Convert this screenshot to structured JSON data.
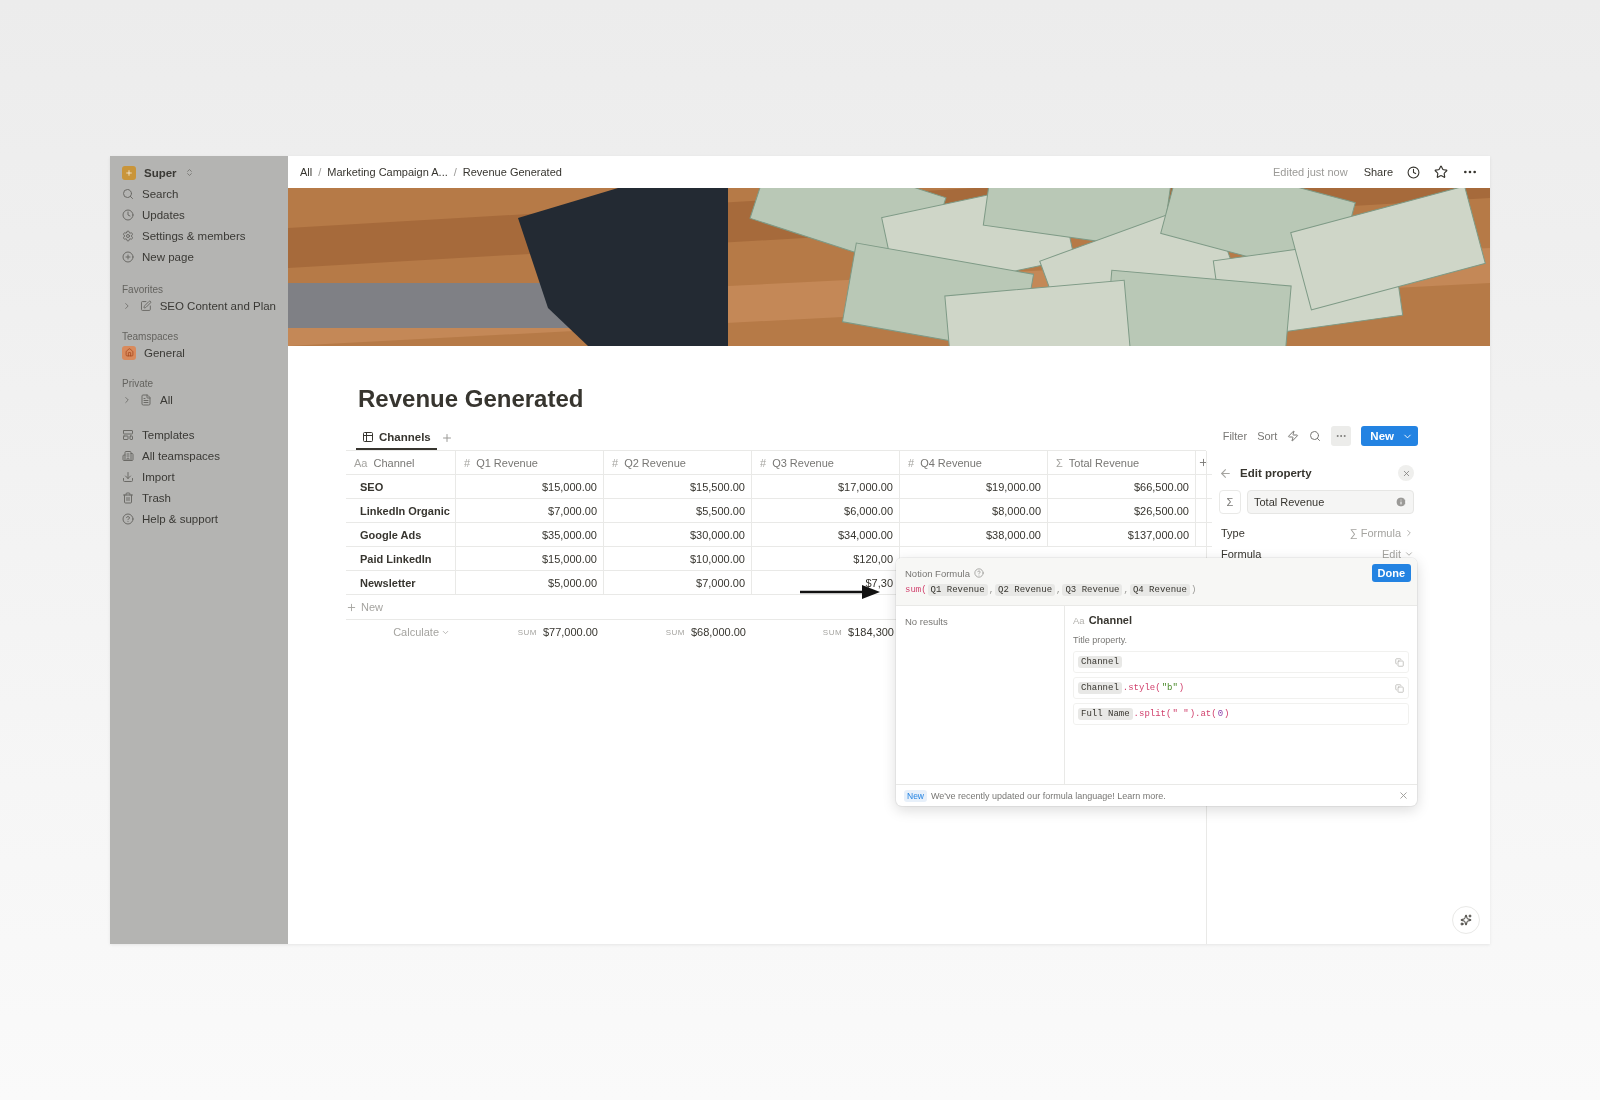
{
  "sidebar": {
    "workspace": {
      "name": "Super"
    },
    "nav": [
      {
        "label": "Search"
      },
      {
        "label": "Updates"
      },
      {
        "label": "Settings & members"
      },
      {
        "label": "New page"
      }
    ],
    "sections": [
      {
        "title": "Favorites",
        "items": [
          {
            "label": "SEO Content and Plan",
            "expanded": false
          }
        ]
      },
      {
        "title": "Teamspaces",
        "items": [
          {
            "label": "General"
          }
        ]
      },
      {
        "title": "Private",
        "items": [
          {
            "label": "All",
            "expanded": false
          }
        ]
      }
    ],
    "tools": [
      {
        "label": "Templates"
      },
      {
        "label": "All teamspaces"
      },
      {
        "label": "Import"
      },
      {
        "label": "Trash"
      },
      {
        "label": "Help & support"
      }
    ]
  },
  "topbar": {
    "breadcrumbs": [
      {
        "kind": "crumb",
        "text": "All"
      },
      {
        "kind": "separator",
        "text": "/"
      },
      {
        "kind": "crumb",
        "text": "Marketing Campaign A..."
      },
      {
        "kind": "separator",
        "text": "/"
      },
      {
        "kind": "crumb",
        "text": "Revenue Generated"
      }
    ],
    "status": "Edited just now",
    "share": "Share"
  },
  "page": {
    "title": "Revenue Generated"
  },
  "views": [
    {
      "label": "Channels",
      "selected": true
    }
  ],
  "toolbar": {
    "filter": "Filter",
    "sort": "Sort",
    "new": "New"
  },
  "table": {
    "columns": [
      {
        "icon": "Aa",
        "name": "Channel"
      },
      {
        "icon": "#",
        "name": "Q1 Revenue"
      },
      {
        "icon": "#",
        "name": "Q2 Revenue"
      },
      {
        "icon": "#",
        "name": "Q3 Revenue"
      },
      {
        "icon": "#",
        "name": "Q4 Revenue"
      },
      {
        "icon": "Σ",
        "name": "Total Revenue"
      }
    ],
    "rows": [
      {
        "cells": [
          "SEO",
          "$15,000.00",
          "$15,500.00",
          "$17,000.00",
          "$19,000.00",
          "$66,500.00"
        ]
      },
      {
        "cells": [
          "LinkedIn Organic",
          "$7,000.00",
          "$5,500.00",
          "$6,000.00",
          "$8,000.00",
          "$26,500.00"
        ]
      },
      {
        "cells": [
          "Google Ads",
          "$35,000.00",
          "$30,000.00",
          "$34,000.00",
          "$38,000.00",
          "$137,000.00"
        ]
      },
      {
        "cells": [
          "Paid LinkedIn",
          "$15,000.00",
          "$10,000.00",
          "$120,00"
        ]
      },
      {
        "cells": [
          "Newsletter",
          "$5,000.00",
          "$7,000.00",
          "$7,30"
        ]
      }
    ],
    "new_row": "New",
    "footer": {
      "calculate": "Calculate",
      "sums": [
        {
          "label": "SUM",
          "value": "$77,000.00"
        },
        {
          "label": "SUM",
          "value": "$68,000.00"
        },
        {
          "label": "SUM",
          "value": "$184,300"
        }
      ]
    }
  },
  "edit_property": {
    "title": "Edit property",
    "type_symbol": "Σ",
    "name": "Total Revenue",
    "rows": [
      {
        "kind": "link",
        "label": "Type",
        "symbol": "∑",
        "value": "Formula"
      },
      {
        "kind": "dropdown",
        "label": "Formula",
        "value": "Edit"
      }
    ]
  },
  "formula_editor": {
    "title": "Notion Formula",
    "done": "Done",
    "formula": [
      {
        "kind": "function",
        "text": "sum("
      },
      {
        "kind": "property",
        "text": "Q1 Revenue"
      },
      {
        "kind": "punct",
        "text": ","
      },
      {
        "kind": "property",
        "text": "Q2 Revenue"
      },
      {
        "kind": "punct",
        "text": ","
      },
      {
        "kind": "property",
        "text": "Q3 Revenue"
      },
      {
        "kind": "punct",
        "text": ","
      },
      {
        "kind": "property",
        "text": "Q4 Revenue"
      },
      {
        "kind": "punct",
        "text": ")"
      }
    ],
    "results": "No results",
    "property": {
      "icon": "Aa",
      "name": "Channel",
      "description": "Title property.",
      "examples": [
        {
          "copyable": true,
          "tokens": [
            {
              "kind": "property",
              "text": "Channel"
            }
          ]
        },
        {
          "copyable": true,
          "tokens": [
            {
              "kind": "property",
              "text": "Channel"
            },
            {
              "kind": "function",
              "text": ".style("
            },
            {
              "kind": "string",
              "text": "\"b\""
            },
            {
              "kind": "function",
              "text": ")"
            }
          ]
        },
        {
          "copyable": false,
          "tokens": [
            {
              "kind": "property",
              "text": "Full Name"
            },
            {
              "kind": "function",
              "text": ".split("
            },
            {
              "kind": "function",
              "text": "\" \""
            },
            {
              "kind": "function",
              "text": ").at("
            },
            {
              "kind": "number",
              "text": "0"
            },
            {
              "kind": "function",
              "text": ")"
            }
          ]
        }
      ]
    },
    "notice": {
      "badge": "New",
      "text": "We've recently updated our formula language! Learn more."
    }
  }
}
